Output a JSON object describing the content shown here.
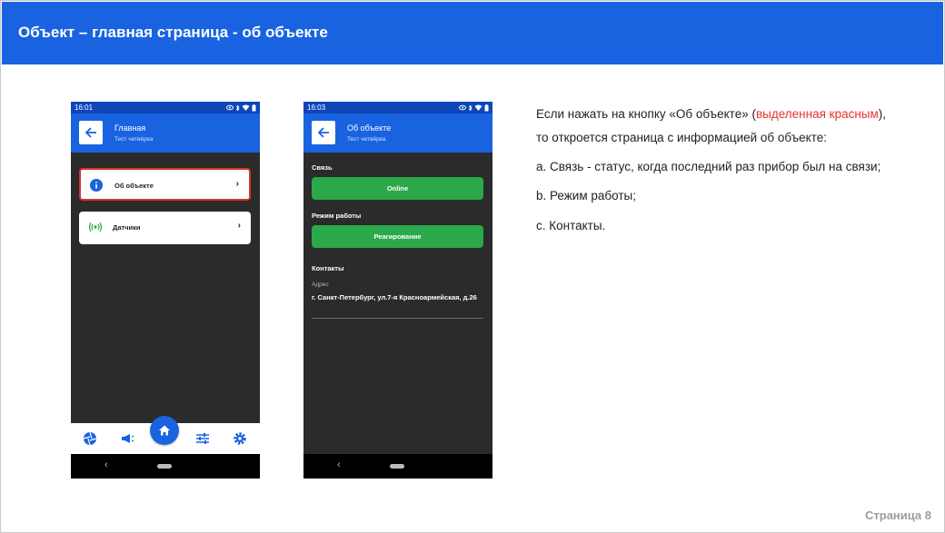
{
  "slide": {
    "title": "Объект – главная страница - об объекте",
    "page_number": "Страница 8"
  },
  "colors": {
    "header_blue": "#1a63e0",
    "status_blue": "#0e46b8",
    "green": "#2ba84a",
    "highlight_red": "#d9342b",
    "dark_bg": "#2b2b2b"
  },
  "phone1": {
    "time": "16:01",
    "app_title": "Главная",
    "app_subtitle": "Тест четвёрка",
    "cards": [
      {
        "label": "Об объекте",
        "icon": "info-icon",
        "highlighted": true
      },
      {
        "label": "Датчики",
        "icon": "sensor-icon",
        "highlighted": false
      }
    ],
    "nav_icons": [
      "shutter-icon",
      "megaphone-icon",
      "home-icon",
      "sliders-icon",
      "gear-icon"
    ]
  },
  "phone2": {
    "time": "16:03",
    "app_title": "Об объекте",
    "app_subtitle": "Тест четвёрка",
    "connection_label": "Связь",
    "connection_status": "Online",
    "mode_label": "Режим работы",
    "mode_value": "Реагирование",
    "contacts_label": "Контакты",
    "address_label": "Адрес",
    "address_value": "г. Санкт-Петербург, ул.7-я Красноармейская, д.26"
  },
  "description": {
    "line1_before": "Если нажать на кнопку «Об объекте» (",
    "line1_red": "выделенная красным",
    "line1_after": "),",
    "line2": "то откроется страница с информацией об объекте:",
    "items": [
      "a. Связь - статус, когда последний раз прибор был на связи;",
      "b. Режим работы;",
      "c. Контакты."
    ]
  }
}
